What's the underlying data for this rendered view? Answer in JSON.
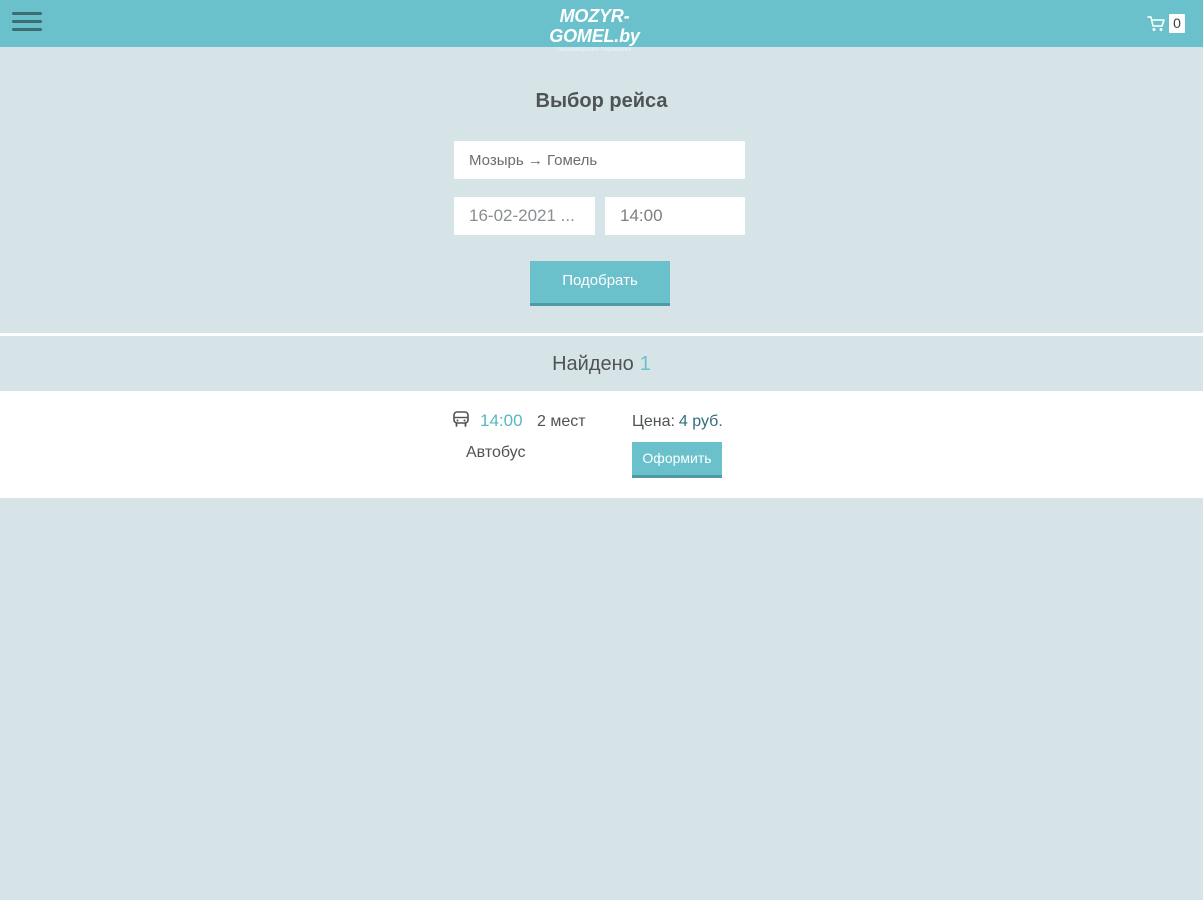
{
  "header": {
    "menu_icon": "hamburger-menu-icon",
    "logo_text": "MOZYR-GOMEL.by",
    "logo_tagline": "пассажирские перевозки",
    "cart_icon": "shopping-cart-icon",
    "cart_count": "0"
  },
  "search": {
    "title": "Выбор рейса",
    "route_value": "Мозырь → Гомель",
    "date_value": "16-02-2021 ...",
    "time_value": "14:00",
    "submit_label": "Подобрать"
  },
  "results": {
    "found_label": "Найдено",
    "found_count": "1",
    "trips": [
      {
        "icon": "bus-icon",
        "time": "14:00",
        "seats": "2 мест",
        "vehicle": "Автобус",
        "price_label": "Цена:",
        "price_value": "4 руб.",
        "order_label": "Оформить"
      }
    ]
  },
  "colors": {
    "brand": "#6ac1cc",
    "background": "#d6e4e7",
    "panel": "#ffffff",
    "text": "#4f5356"
  }
}
